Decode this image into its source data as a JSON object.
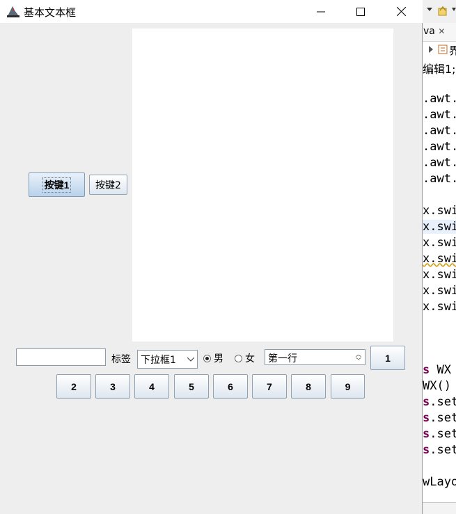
{
  "window": {
    "title": "基本文本框"
  },
  "buttons": {
    "btn1": "按键1",
    "btn2": "按键2"
  },
  "label": "标签",
  "combo": {
    "selected": "下拉框1"
  },
  "radios": [
    {
      "label": "男",
      "selected": true
    },
    {
      "label": "女",
      "selected": false
    }
  ],
  "spinner": {
    "value": "第一行"
  },
  "number_buttons": [
    "1",
    "2",
    "3",
    "4",
    "5",
    "6",
    "7",
    "8",
    "9"
  ],
  "ide": {
    "tab": "va",
    "outline": "界",
    "code_lines": [
      "编辑1;",
      ".awt.",
      ".awt.",
      ".awt.",
      ".awt.",
      ".awt.",
      ".awt.",
      "x.swi",
      "x.swi",
      "x.swi",
      "x.swi",
      "x.swi",
      "x.swi",
      "x.swi",
      "s WX",
      "WX()",
      "s.set",
      "s.set",
      "s.set",
      "s.set",
      "wLayo"
    ]
  }
}
